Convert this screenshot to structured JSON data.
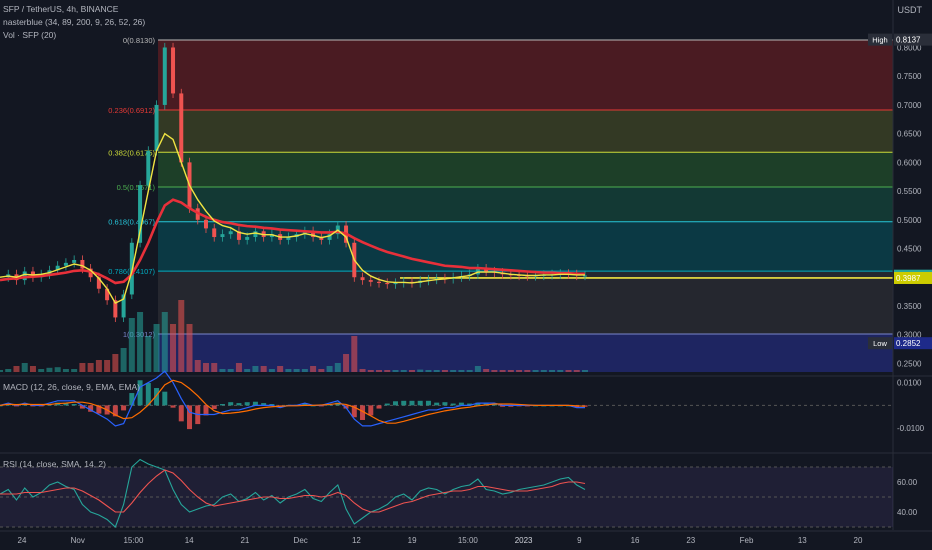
{
  "header": {
    "symbol": "SFP / TetherUS, 4h, BINANCE",
    "indicator": "nasterblue (34, 89, 200, 9, 26, 52, 26)",
    "volume": "Vol · SFP (20)",
    "currency": "USDT"
  },
  "macd_label": "MACD (12, 26, close, 9, EMA, EMA)",
  "rsi_label": "RSI (14, close, SMA, 14, 2)",
  "colors": {
    "background": "#131722",
    "up": "#26a69a",
    "down": "#ef5350",
    "ema_red": "#e8303a",
    "ema_yellow": "#f0e442",
    "macd": "#2962ff",
    "signal": "#ff6d00",
    "rsi": "#7e57c2"
  },
  "chart_data": [
    {
      "type": "line",
      "panel": "price",
      "ylim": [
        0.235,
        0.82
      ],
      "y_ticks": [
        "0.8000",
        "0.7500",
        "0.7000",
        "0.6500",
        "0.6000",
        "0.5500",
        "0.5000",
        "0.4500",
        "0.4000",
        "0.3500",
        "0.3000",
        "0.2500"
      ],
      "x_ticks": [
        "24",
        "Nov",
        "15:00",
        "14",
        "21",
        "Dec",
        "12",
        "19",
        "15:00",
        "2023",
        "9",
        "16",
        "23",
        "Feb",
        "13",
        "20"
      ],
      "fib_levels": [
        {
          "ratio_label": "0(0.8130)",
          "value": 0.813
        },
        {
          "ratio_label": "0.236(0.6912)",
          "value": 0.6912
        },
        {
          "ratio_label": "0.382(0.6175)",
          "value": 0.6175
        },
        {
          "ratio_label": "0.5(0.5571)",
          "value": 0.5571
        },
        {
          "ratio_label": "0.618(0.4967)",
          "value": 0.4967
        },
        {
          "ratio_label": "0.786(0.4107)",
          "value": 0.4107
        },
        {
          "ratio_label": "1(0.3012)",
          "value": 0.3012
        }
      ],
      "price_labels": [
        {
          "label": "High",
          "value": "0.8137"
        },
        {
          "label": "",
          "value": "0.4027"
        },
        {
          "label": "",
          "value": "0.3987"
        },
        {
          "label": "Low",
          "value": "0.2852"
        }
      ],
      "series": [
        {
          "x": [
            0,
            1,
            2,
            3,
            4,
            5,
            6,
            7,
            8,
            9,
            10,
            11,
            12,
            13,
            14,
            15,
            16,
            17,
            18,
            19,
            20,
            21,
            22,
            23,
            24,
            25,
            26,
            27,
            28,
            29,
            30,
            31,
            32,
            33,
            34,
            35,
            36,
            37,
            38,
            39,
            40,
            41,
            42,
            43,
            44,
            45,
            46,
            47,
            48,
            49,
            50,
            51,
            52,
            53,
            54,
            55,
            56,
            57,
            58,
            59,
            60,
            61,
            62,
            63,
            64,
            65,
            66,
            67,
            68,
            69,
            70,
            71
          ],
          "values": [
            0.4,
            0.405,
            0.395,
            0.41,
            0.4,
            0.405,
            0.412,
            0.42,
            0.425,
            0.43,
            0.415,
            0.4,
            0.38,
            0.36,
            0.33,
            0.37,
            0.46,
            0.56,
            0.62,
            0.7,
            0.8,
            0.72,
            0.6,
            0.52,
            0.5,
            0.485,
            0.47,
            0.475,
            0.48,
            0.465,
            0.47,
            0.48,
            0.47,
            0.475,
            0.465,
            0.47,
            0.475,
            0.48,
            0.47,
            0.465,
            0.475,
            0.49,
            0.46,
            0.4,
            0.395,
            0.392,
            0.39,
            0.388,
            0.39,
            0.392,
            0.39,
            0.394,
            0.396,
            0.398,
            0.397,
            0.4,
            0.402,
            0.405,
            0.415,
            0.41,
            0.408,
            0.405,
            0.404,
            0.403,
            0.402,
            0.403,
            0.404,
            0.405,
            0.406,
            0.405,
            0.403,
            0.403
          ]
        },
        {
          "values": [
            0.395,
            0.397,
            0.398,
            0.4,
            0.401,
            0.402,
            0.404,
            0.406,
            0.408,
            0.411,
            0.412,
            0.41,
            0.405,
            0.398,
            0.39,
            0.392,
            0.405,
            0.43,
            0.46,
            0.495,
            0.525,
            0.535,
            0.53,
            0.52,
            0.512,
            0.505,
            0.5,
            0.496,
            0.494,
            0.491,
            0.489,
            0.488,
            0.486,
            0.485,
            0.483,
            0.482,
            0.481,
            0.48,
            0.479,
            0.478,
            0.478,
            0.479,
            0.476,
            0.468,
            0.461,
            0.455,
            0.449,
            0.444,
            0.44,
            0.436,
            0.432,
            0.429,
            0.426,
            0.423,
            0.42,
            0.419,
            0.418,
            0.416,
            0.416,
            0.415,
            0.414,
            0.413,
            0.412,
            0.411,
            0.41,
            0.409,
            0.408,
            0.408,
            0.407,
            0.407,
            0.406,
            0.406
          ]
        },
        {
          "values": [
            0.4,
            0.402,
            0.4,
            0.405,
            0.404,
            0.405,
            0.408,
            0.413,
            0.418,
            0.423,
            0.42,
            0.412,
            0.398,
            0.38,
            0.355,
            0.362,
            0.41,
            0.48,
            0.55,
            0.62,
            0.65,
            0.64,
            0.6,
            0.56,
            0.535,
            0.515,
            0.498,
            0.49,
            0.486,
            0.478,
            0.475,
            0.477,
            0.474,
            0.474,
            0.47,
            0.47,
            0.472,
            0.476,
            0.473,
            0.469,
            0.472,
            0.482,
            0.47,
            0.43,
            0.412,
            0.402,
            0.396,
            0.392,
            0.391,
            0.391,
            0.39,
            0.392,
            0.394,
            0.396,
            0.397,
            0.399,
            0.401,
            0.403,
            0.409,
            0.409,
            0.409,
            0.407,
            0.405,
            0.404,
            0.403,
            0.403,
            0.404,
            0.404,
            0.405,
            0.405,
            0.404,
            0.404
          ]
        }
      ]
    },
    {
      "type": "line",
      "panel": "macd",
      "ylim": [
        -0.02,
        0.012
      ],
      "y_ticks": [
        "0.0100",
        "-0.0100"
      ],
      "series": [
        {
          "values": [
            0.0,
            0.001,
            0.0,
            0.001,
            0.0,
            0.0,
            0.001,
            0.002,
            0.002,
            0.002,
            0.0,
            -0.002,
            -0.004,
            -0.006,
            -0.009,
            -0.008,
            0.0,
            0.008,
            0.01,
            0.012,
            0.015,
            0.01,
            0.003,
            -0.003,
            -0.004,
            -0.004,
            -0.004,
            -0.003,
            -0.002,
            -0.002,
            -0.001,
            0.0,
            0.0,
            0.0,
            -0.001,
            0.0,
            0.0,
            0.001,
            0.0,
            0.0,
            0.001,
            0.002,
            -0.001,
            -0.006,
            -0.009,
            -0.009,
            -0.008,
            -0.007,
            -0.006,
            -0.005,
            -0.004,
            -0.003,
            -0.002,
            -0.002,
            -0.001,
            -0.001,
            0.0,
            0.0,
            0.001,
            0.001,
            0.001,
            0.0,
            0.0,
            0.0,
            0.0,
            0.0,
            0.0,
            0.0,
            0.0,
            0.0,
            -0.001,
            -0.001
          ]
        }
      ]
    },
    {
      "type": "line",
      "panel": "rsi",
      "ylim": [
        28,
        78
      ],
      "y_ticks": [
        "60.00",
        "40.00"
      ],
      "series": [
        {
          "values": [
            52,
            55,
            48,
            56,
            50,
            53,
            58,
            60,
            57,
            55,
            45,
            40,
            38,
            35,
            30,
            45,
            70,
            75,
            72,
            70,
            68,
            55,
            45,
            40,
            42,
            44,
            45,
            50,
            52,
            47,
            49,
            53,
            48,
            51,
            46,
            50,
            52,
            55,
            49,
            47,
            53,
            58,
            42,
            32,
            36,
            40,
            42,
            45,
            50,
            52,
            48,
            54,
            56,
            55,
            52,
            55,
            57,
            58,
            62,
            55,
            54,
            52,
            53,
            55,
            56,
            57,
            58,
            60,
            62,
            63,
            58,
            55
          ]
        },
        {
          "values": [
            52,
            52,
            52,
            53,
            53,
            53,
            54,
            55,
            56,
            56,
            54,
            51,
            48,
            44,
            40,
            40,
            46,
            53,
            59,
            64,
            68,
            66,
            61,
            55,
            50,
            46,
            44,
            45,
            46,
            47,
            48,
            49,
            50,
            50,
            49,
            49,
            50,
            51,
            51,
            50,
            51,
            53,
            51,
            46,
            42,
            40,
            40,
            42,
            44,
            46,
            47,
            49,
            51,
            52,
            53,
            54,
            54,
            55,
            57,
            57,
            56,
            55,
            54,
            54,
            54,
            55,
            56,
            57,
            59,
            60,
            60,
            59
          ]
        }
      ]
    }
  ]
}
